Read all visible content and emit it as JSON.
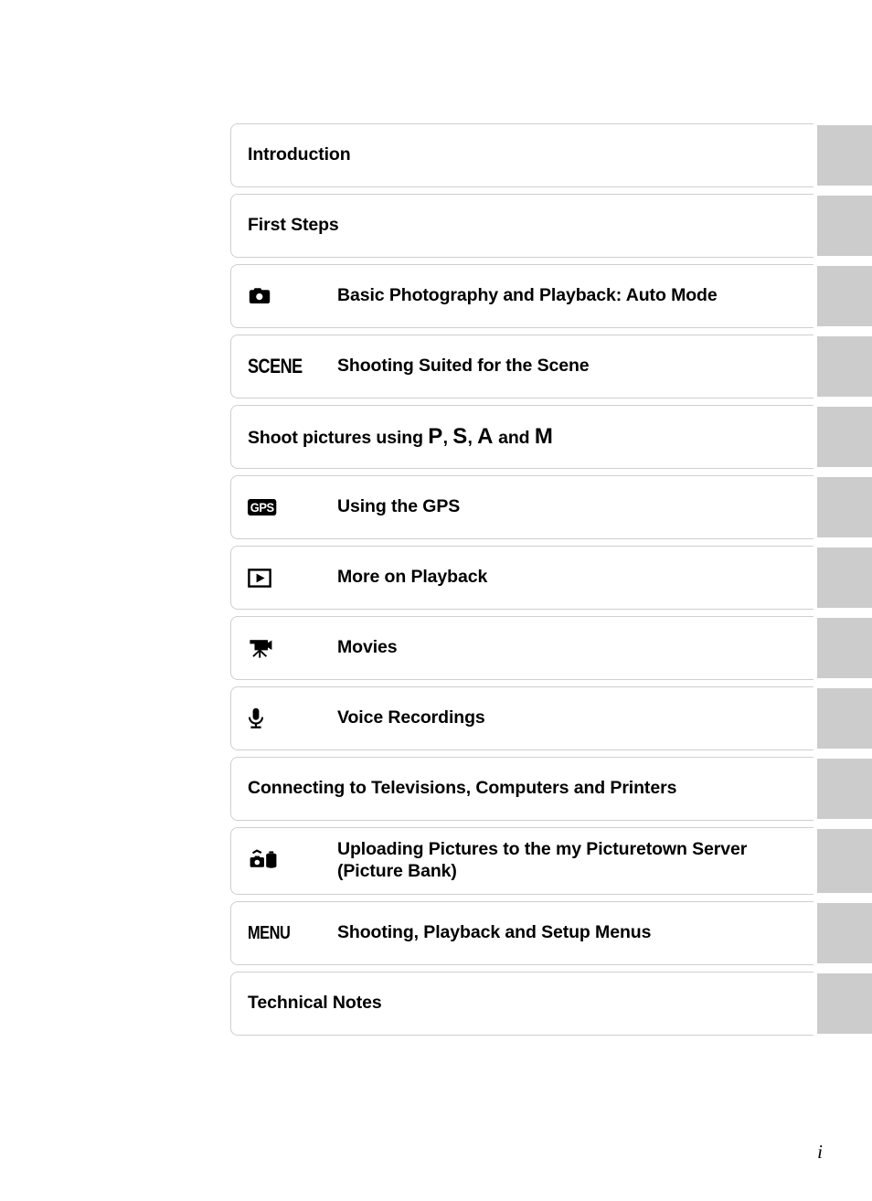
{
  "document": {
    "page_number": "i"
  },
  "toc": {
    "entries": [
      {
        "icon": "none",
        "icon_text": "",
        "label": "Introduction",
        "label2": ""
      },
      {
        "icon": "none",
        "icon_text": "",
        "label": "First Steps",
        "label2": ""
      },
      {
        "icon": "camera-icon",
        "icon_text": "",
        "label": "Basic Photography and Playback: Auto Mode",
        "label2": ""
      },
      {
        "icon": "scene-text-icon",
        "icon_text": "SCENE",
        "label": "Shooting Suited for the Scene",
        "label2": ""
      },
      {
        "icon": "none",
        "icon_text": "",
        "label": "Shoot pictures using P, S, A and M",
        "label2": "",
        "mode_letters": [
          "P",
          "S",
          "A",
          "M"
        ],
        "prefix": "Shoot pictures using ",
        "joiner": " and "
      },
      {
        "icon": "gps-badge-icon",
        "icon_text": "GPS",
        "label": "Using the GPS",
        "label2": ""
      },
      {
        "icon": "playback-icon",
        "icon_text": "",
        "label": "More on Playback",
        "label2": ""
      },
      {
        "icon": "movie-camera-icon",
        "icon_text": "",
        "label": "Movies",
        "label2": ""
      },
      {
        "icon": "microphone-icon",
        "icon_text": "",
        "label": "Voice Recordings",
        "label2": ""
      },
      {
        "icon": "none",
        "icon_text": "",
        "label": "Connecting to Televisions, Computers and Printers",
        "label2": ""
      },
      {
        "icon": "upload-picturetown-icon",
        "icon_text": "",
        "label": "Uploading Pictures to the my Picturetown Server",
        "label2": "(Picture Bank)"
      },
      {
        "icon": "menu-text-icon",
        "icon_text": "MENU",
        "label": "Shooting, Playback and Setup Menus",
        "label2": ""
      },
      {
        "icon": "none",
        "icon_text": "",
        "label": "Technical Notes",
        "label2": ""
      }
    ]
  },
  "colors": {
    "tab_gray": "#cccccc",
    "box_border": "#cfcfcf",
    "text": "#000000",
    "page_background": "#ffffff"
  }
}
